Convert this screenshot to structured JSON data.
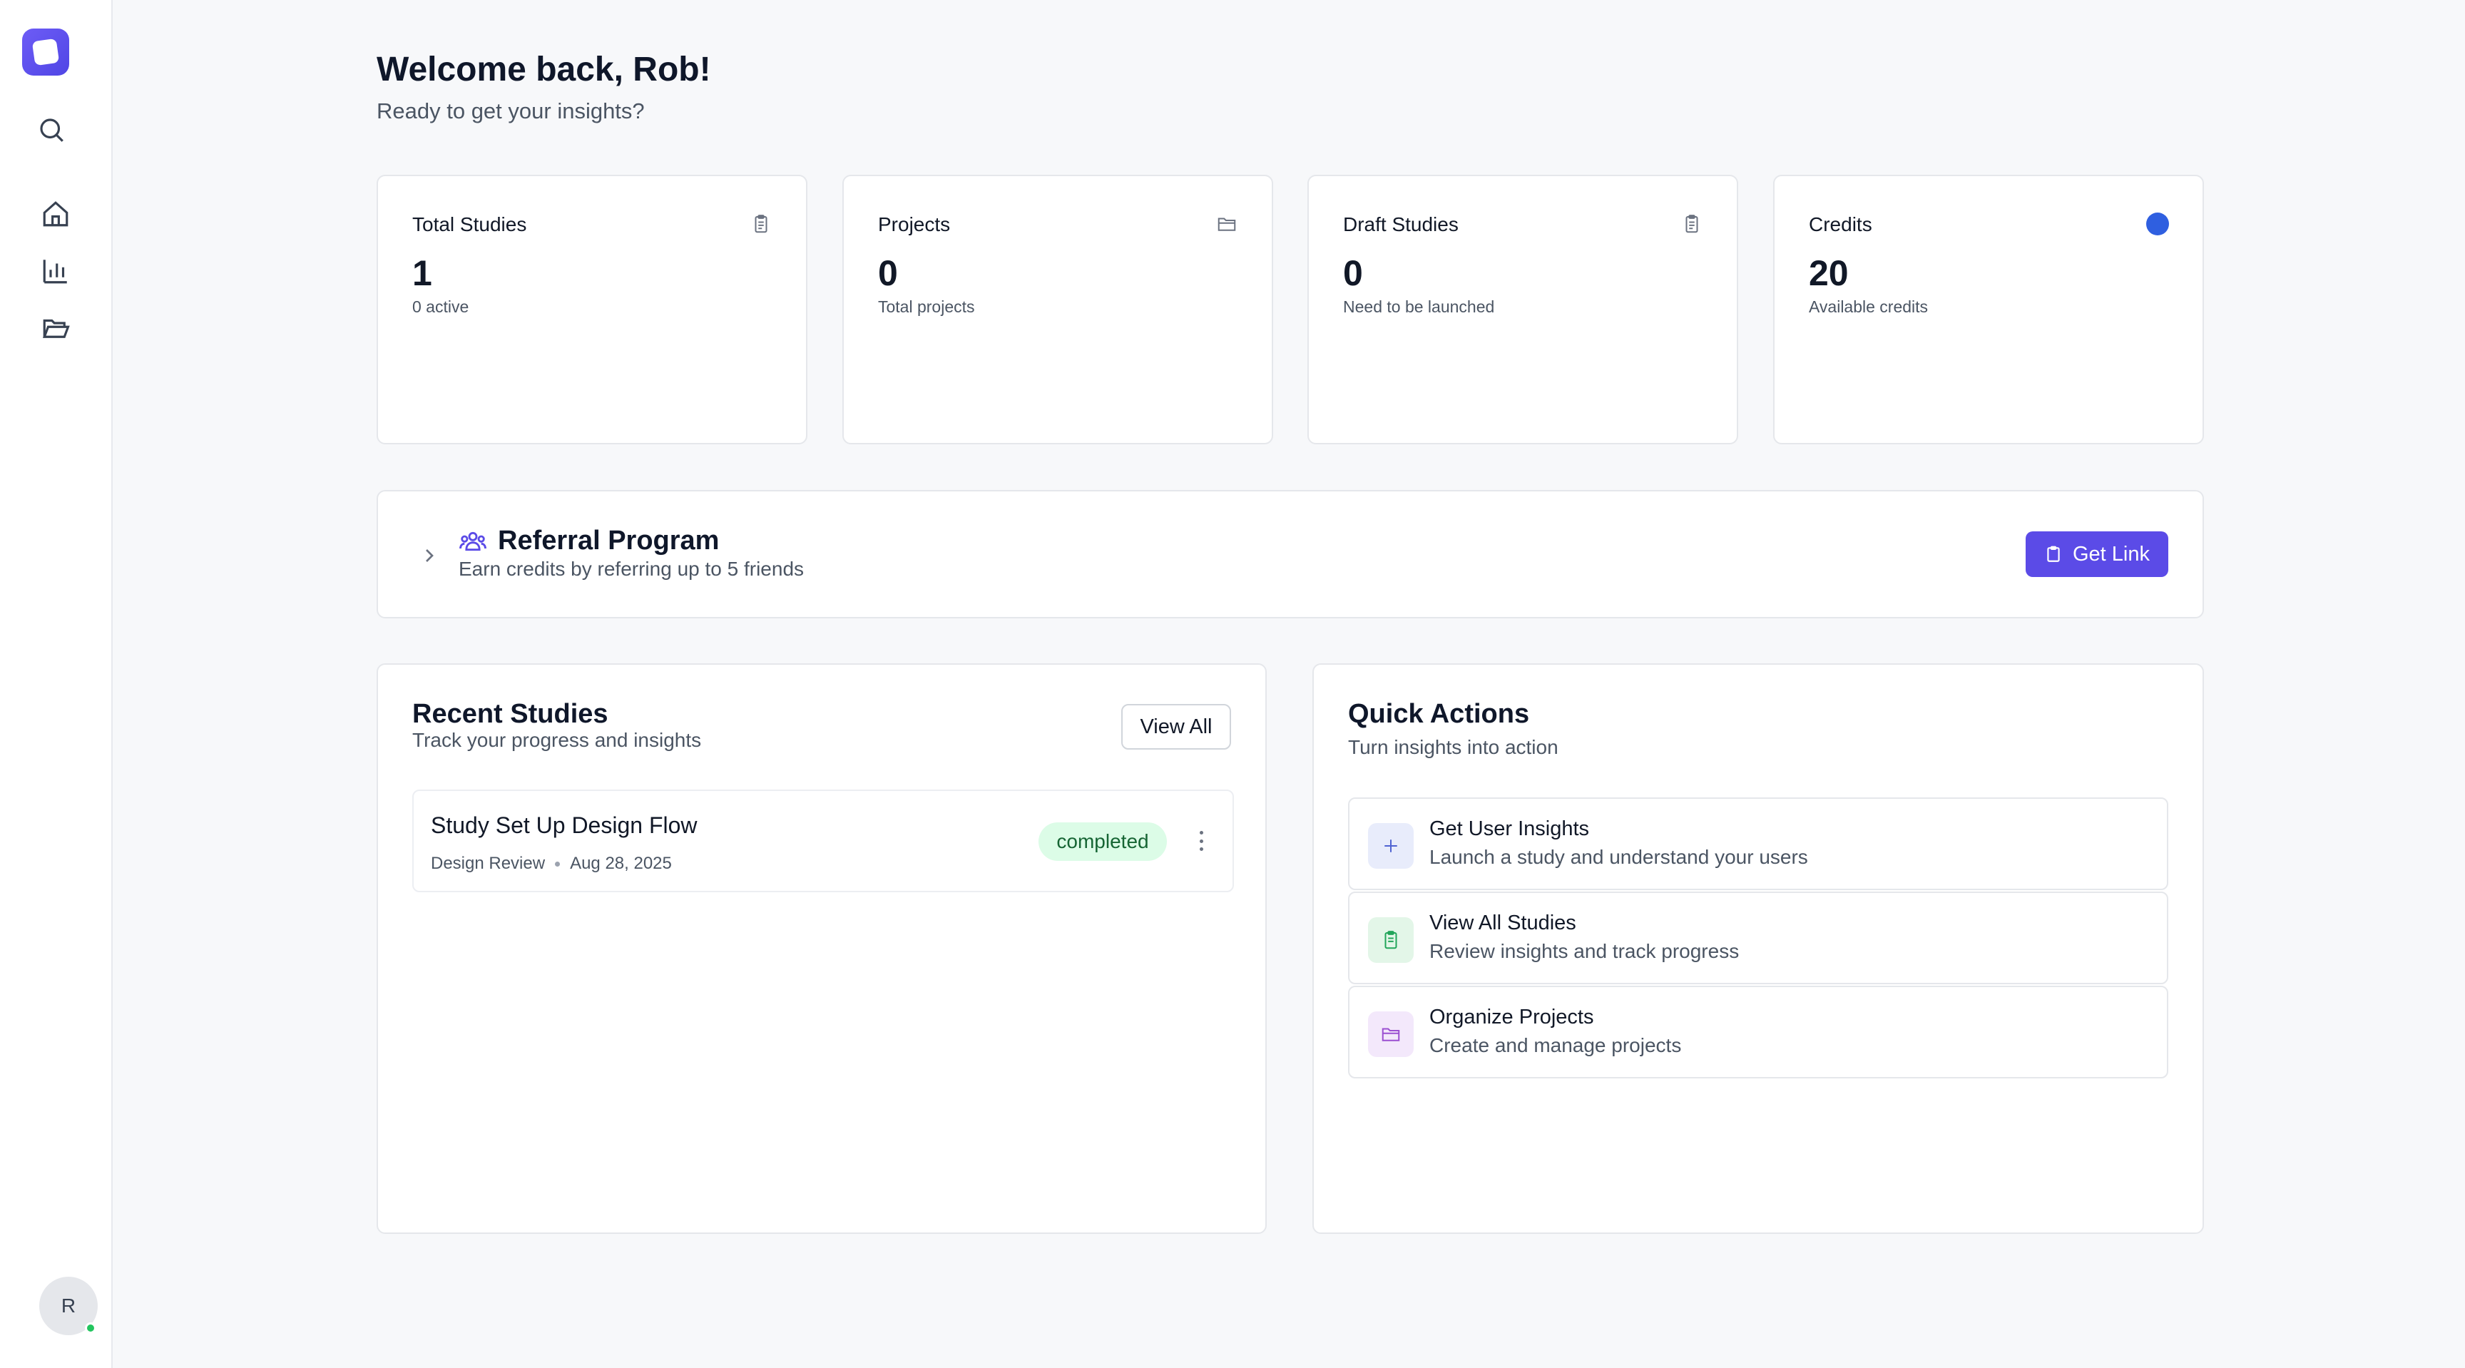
{
  "sidebar": {
    "avatar_initial": "R",
    "icons": [
      "search-icon",
      "home-icon",
      "chart-icon",
      "folder-open-icon"
    ]
  },
  "header": {
    "title": "Welcome back, Rob!",
    "subtitle": "Ready to get your insights?"
  },
  "stats": [
    {
      "title": "Total Studies",
      "value": "1",
      "sub": "0 active",
      "icon": "clipboard-icon"
    },
    {
      "title": "Projects",
      "value": "0",
      "sub": "Total projects",
      "icon": "folder-icon"
    },
    {
      "title": "Draft Studies",
      "value": "0",
      "sub": "Need to be launched",
      "icon": "clipboard-icon"
    },
    {
      "title": "Credits",
      "value": "20",
      "sub": "Available credits",
      "icon": "credit-dot-icon"
    }
  ],
  "referral": {
    "title": "Referral Program",
    "subtitle": "Earn credits by referring up to 5 friends",
    "button": "Get Link"
  },
  "recent_studies": {
    "title": "Recent Studies",
    "subtitle": "Track your progress and insights",
    "view_all": "View All",
    "items": [
      {
        "name": "Study Set Up Design Flow",
        "type": "Design Review",
        "date": "Aug 28, 2025",
        "status": "completed"
      }
    ]
  },
  "quick_actions": {
    "title": "Quick Actions",
    "subtitle": "Turn insights into action",
    "items": [
      {
        "title": "Get User Insights",
        "sub": "Launch a study and understand your users",
        "icon": "plus-icon"
      },
      {
        "title": "View All Studies",
        "sub": "Review insights and track progress",
        "icon": "clipboard-icon"
      },
      {
        "title": "Organize Projects",
        "sub": "Create and manage projects",
        "icon": "folder-icon"
      }
    ]
  },
  "colors": {
    "accent": "#5b4be7",
    "credit_dot": "#2f5fe0",
    "status_completed_bg": "#dcfce7",
    "status_completed_text": "#166534"
  }
}
